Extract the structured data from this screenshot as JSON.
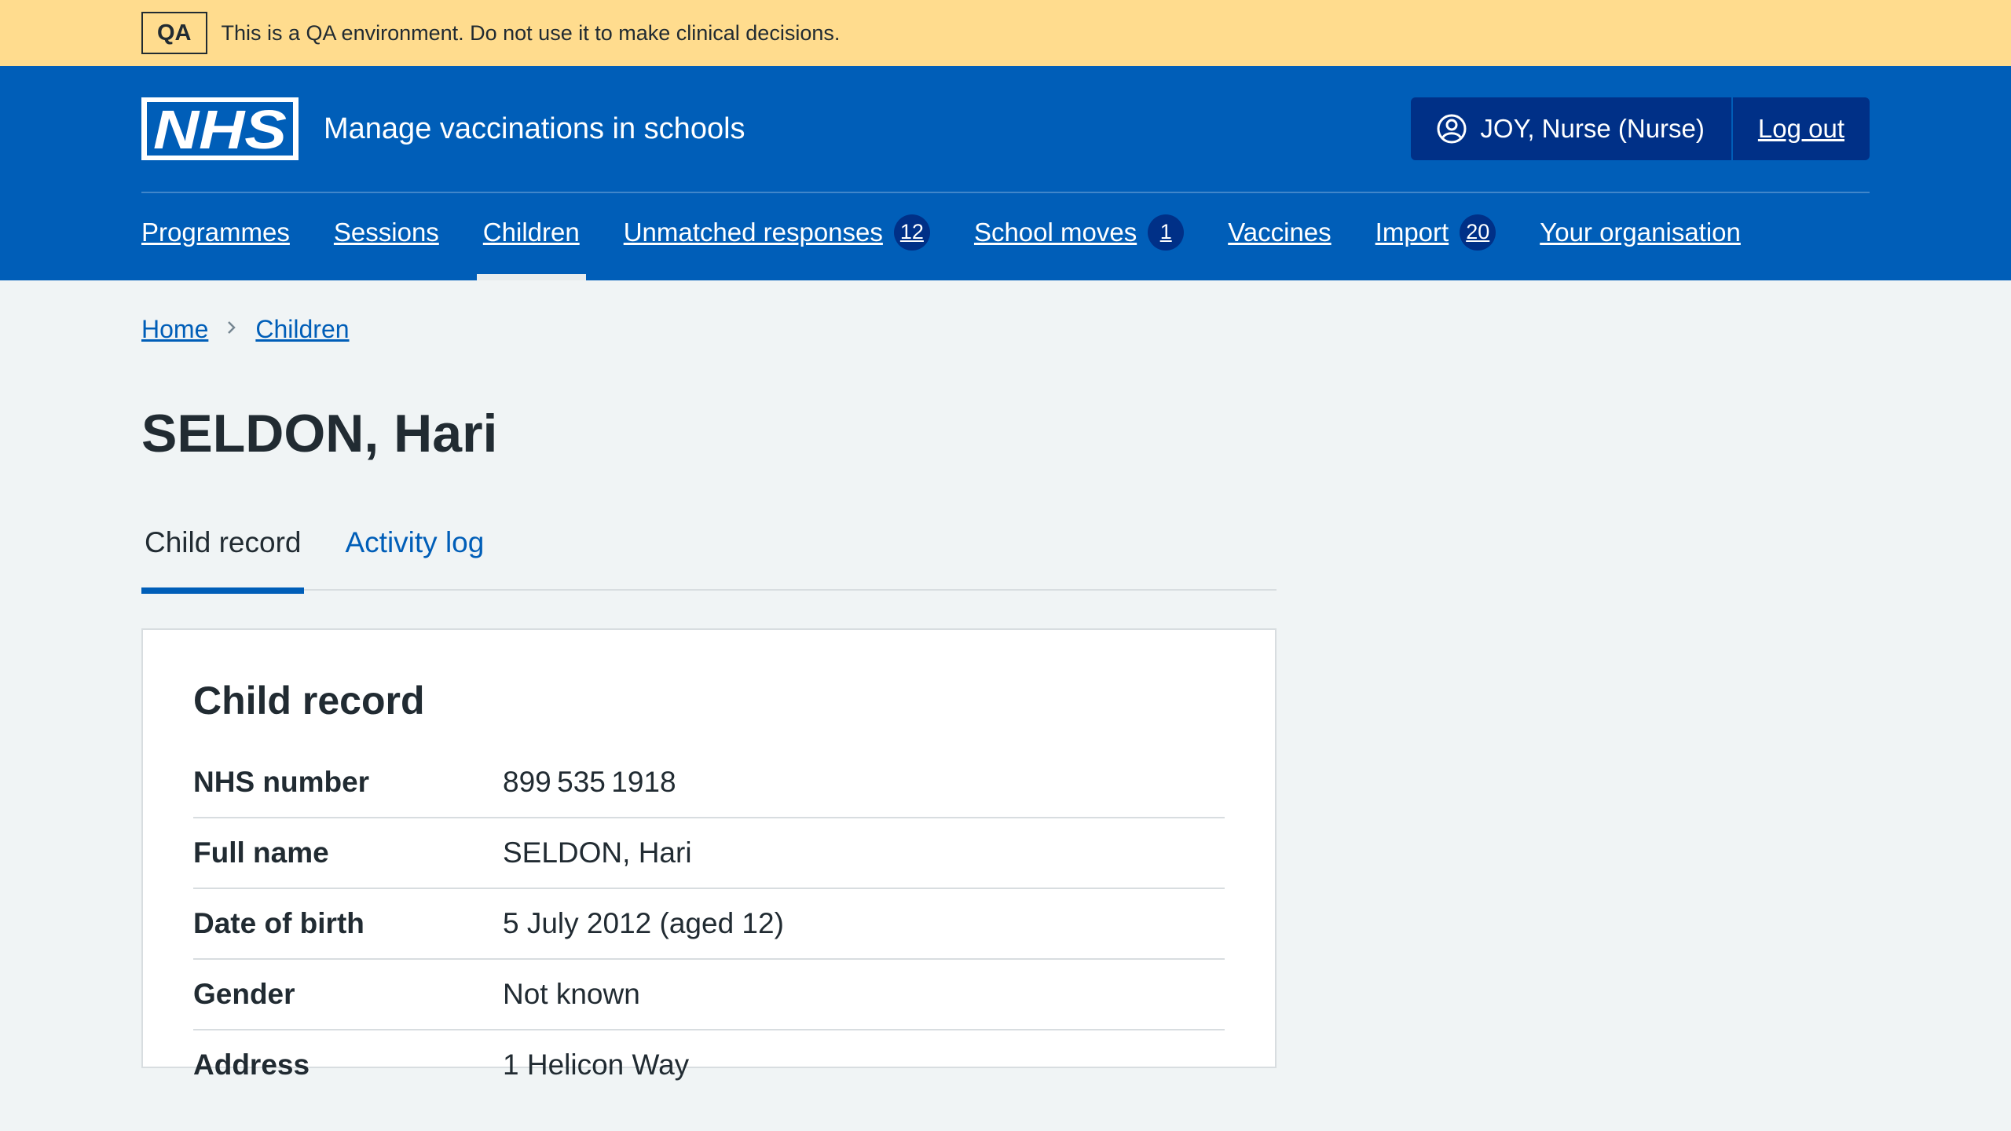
{
  "qa_banner": {
    "tag": "QA",
    "message": "This is a QA environment. Do not use it to make clinical decisions."
  },
  "header": {
    "logo_text": "NHS",
    "service_name": "Manage vaccinations in schools",
    "user_label": "JOY, Nurse (Nurse)",
    "user_icon": "user-circle-icon",
    "logout_label": "Log out"
  },
  "nav": {
    "items": [
      {
        "label": "Programmes"
      },
      {
        "label": "Sessions"
      },
      {
        "label": "Children",
        "active": true
      },
      {
        "label": "Unmatched responses",
        "badge": "12"
      },
      {
        "label": "School moves",
        "badge": "1"
      },
      {
        "label": "Vaccines"
      },
      {
        "label": "Import",
        "badge": "20"
      },
      {
        "label": "Your organisation"
      }
    ]
  },
  "breadcrumb": {
    "items": [
      "Home",
      "Children"
    ],
    "separator_icon": "chevron-right-icon"
  },
  "page": {
    "title": "SELDON, Hari"
  },
  "tabs": {
    "items": [
      {
        "label": "Child record",
        "active": true
      },
      {
        "label": "Activity log"
      }
    ]
  },
  "child_record": {
    "title": "Child record",
    "rows": [
      {
        "key": "NHS number",
        "value": "899 535 1918"
      },
      {
        "key": "Full name",
        "value": "SELDON, Hari"
      },
      {
        "key": "Date of birth",
        "value": "5 July 2012 (aged 12)"
      },
      {
        "key": "Gender",
        "value": "Not known"
      },
      {
        "key": "Address",
        "value": "1 Helicon Way"
      }
    ]
  },
  "colors": {
    "nhs_blue": "#005eb8",
    "nhs_dark_blue": "#003087",
    "qa_banner_bg": "#ffdc8e",
    "page_bg": "#f0f4f5"
  }
}
